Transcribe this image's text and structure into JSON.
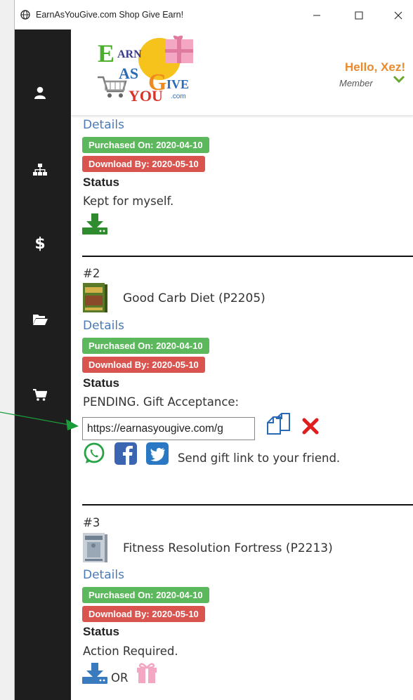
{
  "window": {
    "title": "EarnAsYouGive.com Shop Give Earn!"
  },
  "header": {
    "logo_alt": "EarnAsYouGive.com",
    "greeting": "Hello, Xez!",
    "role": "Member"
  },
  "sidebar": {
    "items": [
      {
        "icon": "user-icon"
      },
      {
        "icon": "sitemap-icon"
      },
      {
        "icon": "dollar-icon"
      },
      {
        "icon": "folder-open-icon"
      },
      {
        "icon": "cart-icon"
      }
    ]
  },
  "orders": [
    {
      "details_label": "Details",
      "purchased": "Purchased On: 2020-04-10",
      "download_by": "Download By: 2020-05-10",
      "status_label": "Status",
      "status": "Kept for myself."
    },
    {
      "number": "#2",
      "product": "Good Carb Diet (P2205)",
      "details_label": "Details",
      "purchased": "Purchased On: 2020-04-10",
      "download_by": "Download By: 2020-05-10",
      "status_label": "Status",
      "status": "PENDING. Gift Acceptance:",
      "gift_link": "https://earnasyougive.com/g",
      "share_text": "Send gift link to your friend."
    },
    {
      "number": "#3",
      "product": "Fitness Resolution Fortress (P2213)",
      "details_label": "Details",
      "purchased": "Purchased On: 2020-04-10",
      "download_by": "Download By: 2020-05-10",
      "status_label": "Status",
      "status": "Action Required.",
      "or_text": "OR"
    }
  ],
  "colors": {
    "accent_orange": "#e98a2d",
    "green_badge": "#5cb85c",
    "red_badge": "#d9534f",
    "link_blue": "#4a7ab5",
    "sidebar_bg": "#1e1e1e",
    "download_green": "#2e8b2e",
    "download_blue": "#3a7bbf"
  }
}
